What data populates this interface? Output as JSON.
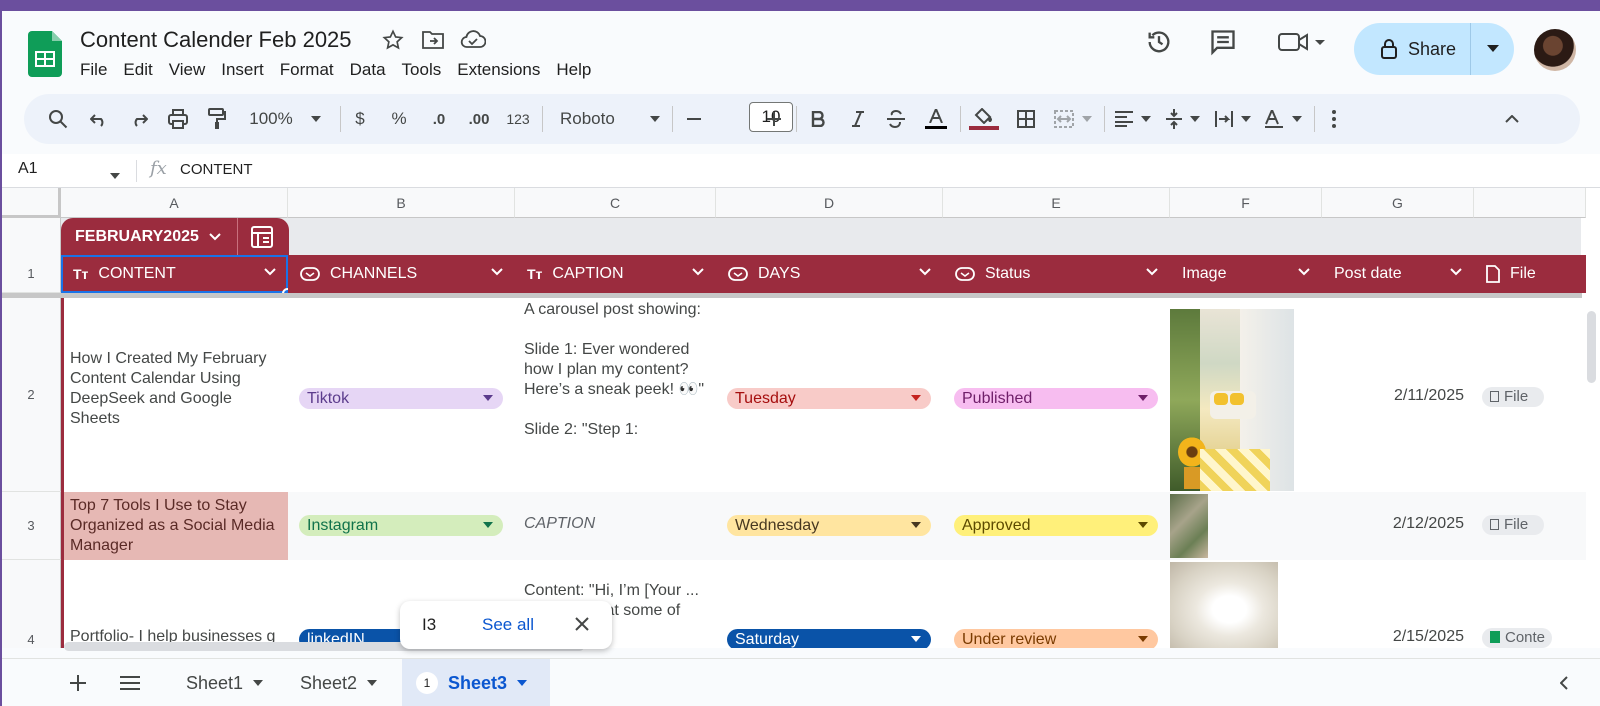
{
  "doc": {
    "title": "Content Calender Feb 2025"
  },
  "menu": [
    "File",
    "Edit",
    "View",
    "Insert",
    "Format",
    "Data",
    "Tools",
    "Extensions",
    "Help"
  ],
  "share": {
    "label": "Share"
  },
  "toolbar": {
    "zoom": "100%",
    "currency": "$",
    "percent": "%",
    "dec_dec": ".0",
    "dec_inc": ".00",
    "num_format": "123",
    "font": "Roboto",
    "font_size": "10"
  },
  "formula": {
    "cell_ref": "A1",
    "fx": "fx",
    "value": "CONTENT"
  },
  "columns": [
    "A",
    "B",
    "C",
    "D",
    "E",
    "F",
    "G"
  ],
  "rows": [
    "1",
    "2",
    "3",
    "4"
  ],
  "table": {
    "name": "FEBRUARY2025",
    "headers": [
      "CONTENT",
      "CHANNELS",
      "CAPTION",
      "DAYS",
      "Status",
      "Image",
      "Post date",
      "File"
    ]
  },
  "data_rows": [
    {
      "content": "How I Created My February Content Calendar Using DeepSeek and Google Sheets",
      "channel": "Tiktok",
      "caption": "A carousel post showing:\n\nSlide 1: Ever wondered how I plan my content? Here’s a sneak peek! 👀\"\n\nSlide 2: \"Step 1:",
      "day": "Tuesday",
      "status": "Published",
      "post_date": "2/11/2025",
      "file": "File"
    },
    {
      "content": "Top 7 Tools I Use to Stay Organized as a Social Media Manager",
      "channel": "Instagram",
      "caption": "CAPTION",
      "day": "Wednesday",
      "status": "Approved",
      "post_date": "2/12/2025",
      "file": "File"
    },
    {
      "content": "Portfolio- I help businesses g",
      "channel": "linkedIN",
      "caption": "Content: \"Hi, I’m [Your ... Here’s a ... at some of",
      "day": "Saturday",
      "status": "Under review",
      "post_date": "2/15/2025",
      "file": "Conte"
    }
  ],
  "colors": {
    "table_header": "#9b2c3e",
    "share_bg": "#c2e7ff",
    "selection": "#1a73e8"
  },
  "popup": {
    "cell": "I3",
    "link": "See all"
  },
  "sheets": [
    {
      "name": "Sheet1"
    },
    {
      "name": "Sheet2"
    },
    {
      "name": "Sheet3",
      "badge": "1",
      "active": true
    }
  ]
}
